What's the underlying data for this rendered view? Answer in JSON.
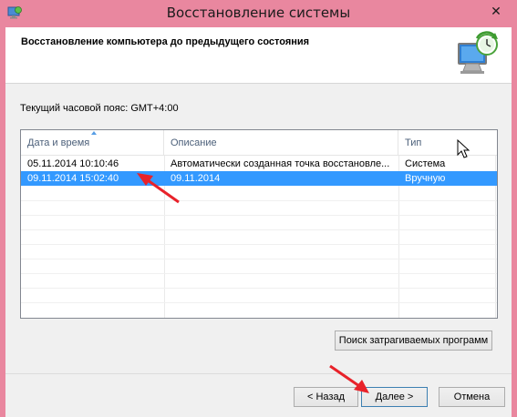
{
  "window": {
    "title": "Восстановление системы",
    "close_glyph": "✕"
  },
  "header": {
    "title": "Восстановление компьютера до предыдущего состояния",
    "icon": "system-restore-icon"
  },
  "timezone_text": "Текущий часовой пояс: GMT+4:00",
  "table": {
    "columns": [
      "Дата и время",
      "Описание",
      "Тип"
    ],
    "sorted_column": "Дата и время",
    "rows": [
      {
        "date": "05.11.2014 10:10:46",
        "description": "Автоматически созданная точка восстановле...",
        "type": "Система",
        "selected": false
      },
      {
        "date": "09.11.2014 15:02:40",
        "description": "09.11.2014",
        "type": "Вручную",
        "selected": true
      }
    ]
  },
  "buttons": {
    "affected": "Поиск затрагиваемых программ",
    "back": "< Назад",
    "next": "Далее >",
    "cancel": "Отмена"
  },
  "colors": {
    "titlebar": "#e9879f",
    "selection": "#3399ff",
    "annotation_arrow": "#e8222a"
  }
}
